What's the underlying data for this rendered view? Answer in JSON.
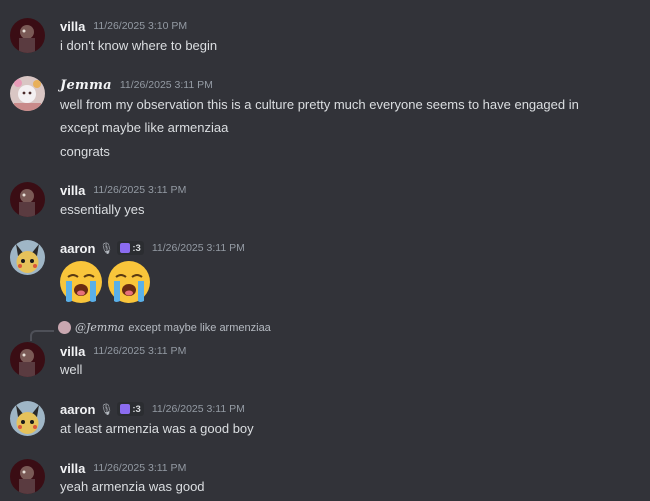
{
  "messages": [
    {
      "user": "villa",
      "timestamp": "11/26/2025 3:10 PM",
      "lines": [
        "i don't know where to begin"
      ]
    },
    {
      "user": "Jemma",
      "timestamp": "11/26/2025 3:11 PM",
      "lines": [
        "well from my observation this is a culture pretty much everyone seems to have engaged in",
        "except maybe like armenziaa",
        "congrats"
      ]
    },
    {
      "user": "villa",
      "timestamp": "11/26/2025 3:11 PM",
      "lines": [
        "essentially yes"
      ]
    },
    {
      "user": "aaron",
      "mic": "🎙",
      "tag": ":3",
      "timestamp": "11/26/2025 3:11 PM",
      "emojis": [
        "loudly-crying-face",
        "loudly-crying-face"
      ]
    },
    {
      "user": "villa",
      "timestamp": "11/26/2025 3:11 PM",
      "reply": {
        "name": "@Jemma",
        "text": "except maybe like armenziaa"
      },
      "lines": [
        "well"
      ]
    },
    {
      "user": "aaron",
      "mic": "🎙",
      "tag": ":3",
      "timestamp": "11/26/2025 3:11 PM",
      "lines": [
        "at least armenzia was a good boy"
      ]
    },
    {
      "user": "villa",
      "timestamp": "11/26/2025 3:11 PM",
      "lines": [
        "yeah armenzia was good"
      ]
    }
  ],
  "colors": {
    "background": "#323339",
    "username": "#f2f3f5",
    "timestamp": "#949ba4",
    "text": "#dbdee1"
  }
}
